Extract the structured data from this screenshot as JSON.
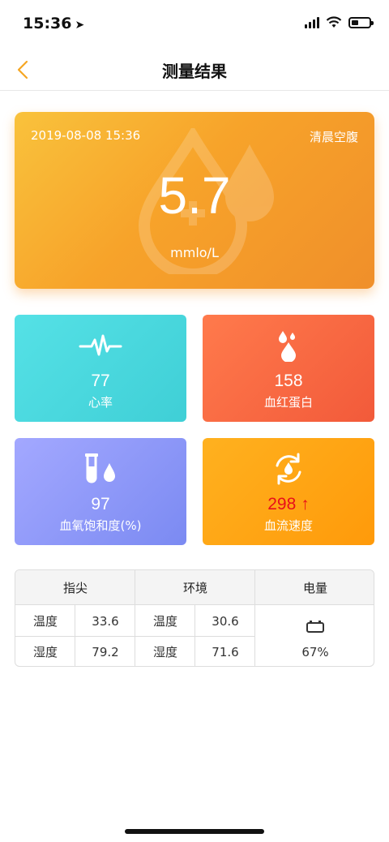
{
  "status_bar": {
    "time": "15:36",
    "location_glyph": "➤"
  },
  "nav": {
    "title": "测量结果"
  },
  "main_card": {
    "datetime": "2019-08-08 15:36",
    "state": "清晨空腹",
    "value": "5.7",
    "unit": "mmlo/L"
  },
  "metrics": {
    "heart_rate": {
      "value": "77",
      "label": "心率",
      "icon": "heartbeat-icon"
    },
    "hemoglobin": {
      "value": "158",
      "label": "血红蛋白",
      "icon": "drops-icon"
    },
    "spo2": {
      "value": "97",
      "label": "血氧饱和度(%)",
      "icon": "test-tube-icon"
    },
    "blood_flow": {
      "value": "298",
      "arrow": "↑",
      "label": "血流速度",
      "icon": "refresh-drop-icon"
    }
  },
  "table": {
    "headers": [
      "指尖",
      "环境",
      "电量"
    ],
    "fingertip": {
      "temp_label": "温度",
      "temp_value": "33.6",
      "humidity_label": "湿度",
      "humidity_value": "79.2"
    },
    "environment": {
      "temp_label": "温度",
      "temp_value": "30.6",
      "humidity_label": "湿度",
      "humidity_value": "71.6"
    },
    "battery": {
      "value": "67%",
      "icon": "battery-icon"
    }
  },
  "colors": {
    "accent": "#f5a623",
    "heart_tile": "#4fdbe0",
    "hemoglobin_tile": "#f8663f",
    "spo2_tile": "#8f98f8",
    "flow_tile": "#ffa412",
    "alert_text": "#e8101a"
  }
}
